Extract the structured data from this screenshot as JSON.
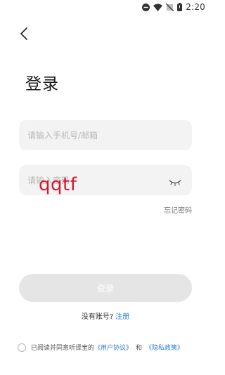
{
  "status_bar": {
    "time": "2:20",
    "icons": [
      "minus-circle-icon",
      "wifi-icon",
      "no-sim-icon",
      "battery-icon"
    ]
  },
  "header": {
    "back_icon": "chevron-left-icon",
    "title": "登录"
  },
  "form": {
    "phone_placeholder": "请输入手机号/邮箱",
    "phone_value": "",
    "password_placeholder": "请输入密码",
    "password_value": "",
    "password_visibility_icon": "eye-closed-icon",
    "typed_overlay_text": "qqtf",
    "forgot_password": "忘记密码",
    "login_button": "登录"
  },
  "register": {
    "prompt": "没有账号?",
    "link": "注册"
  },
  "agreement": {
    "checked": false,
    "text": "已阅读并同意听译宝的",
    "user_agreement": "《用户协议》",
    "and": "和",
    "privacy_policy": "《隐私政策》"
  },
  "colors": {
    "link": "#2f7bd8",
    "input_bg": "#f3f3f3",
    "button_disabled": "#e5e5e5",
    "overlay_text": "#d8172a"
  }
}
